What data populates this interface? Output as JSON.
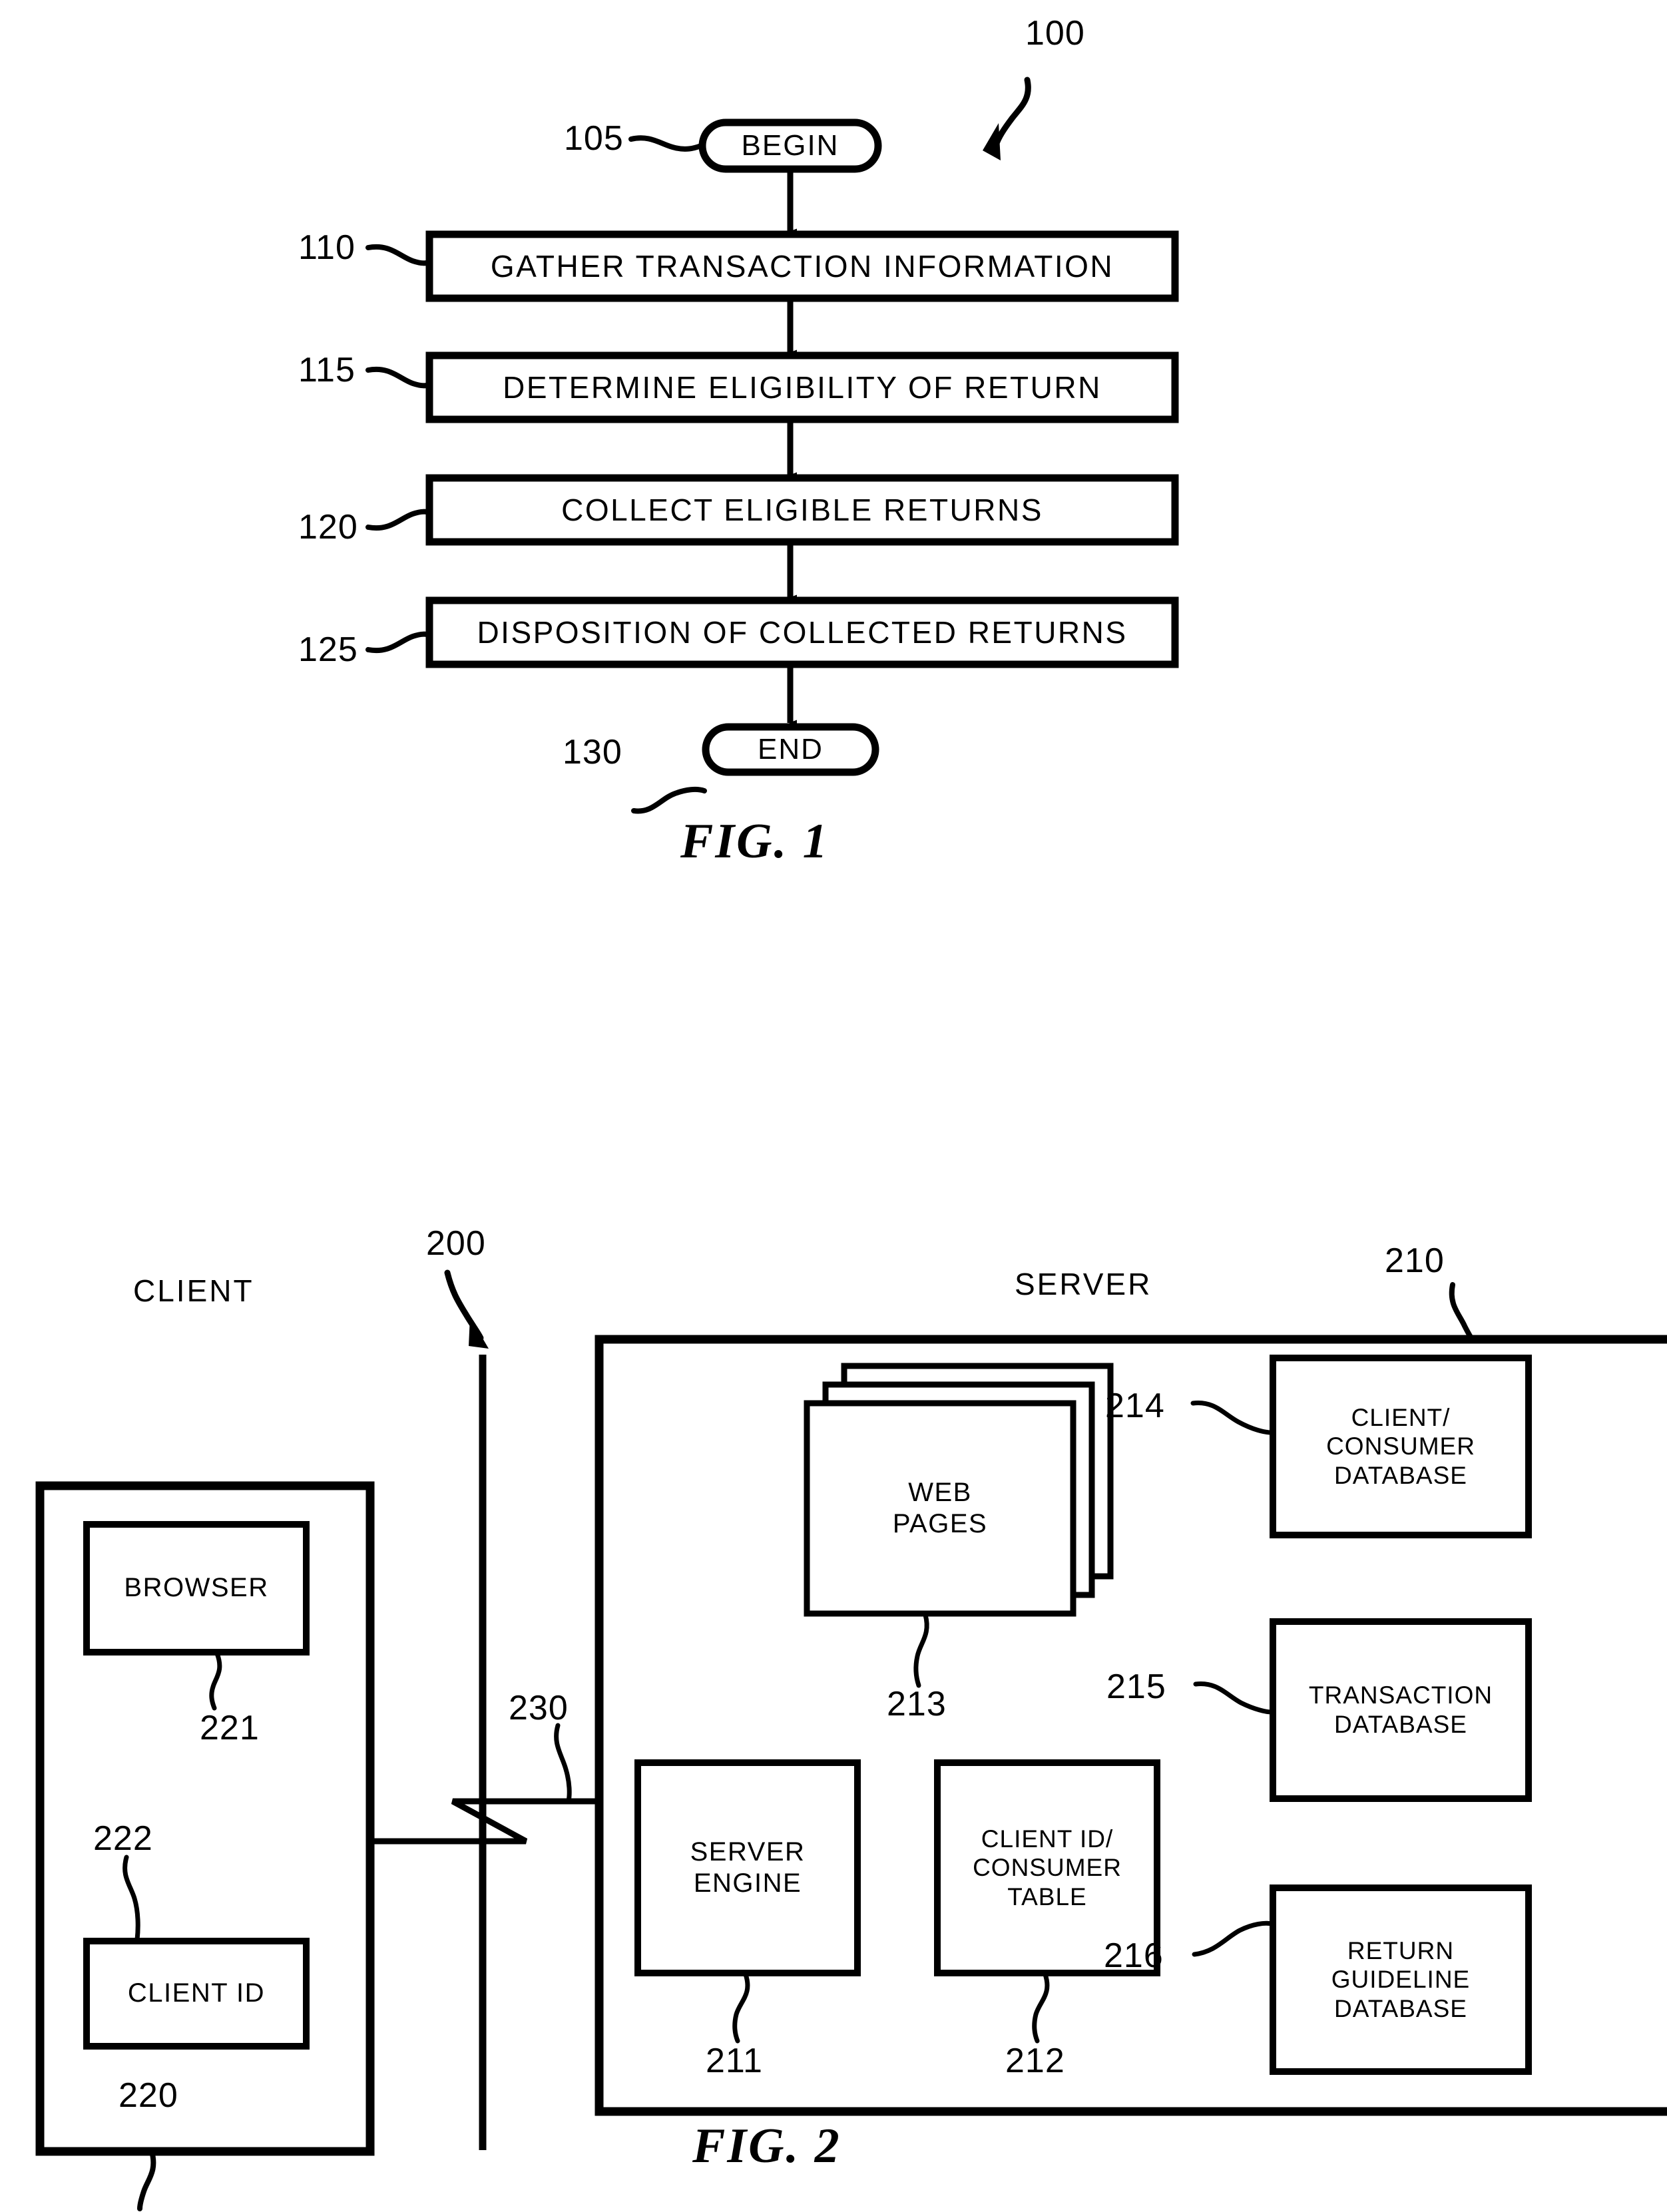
{
  "figure1": {
    "diagram_ref": "100",
    "caption": "FIG.  1",
    "nodes": [
      {
        "ref": "105",
        "label": "BEGIN",
        "shape": "terminator"
      },
      {
        "ref": "110",
        "label": "GATHER TRANSACTION INFORMATION",
        "shape": "process"
      },
      {
        "ref": "115",
        "label": "DETERMINE ELIGIBILITY OF RETURN",
        "shape": "process"
      },
      {
        "ref": "120",
        "label": "COLLECT ELIGIBLE RETURNS",
        "shape": "process"
      },
      {
        "ref": "125",
        "label": "DISPOSITION OF COLLECTED RETURNS",
        "shape": "process"
      },
      {
        "ref": "130",
        "label": "END",
        "shape": "terminator"
      }
    ]
  },
  "figure2": {
    "diagram_ref": "200",
    "caption": "FIG.  2",
    "client_title": "CLIENT",
    "server_title": "SERVER",
    "server_ref": "210",
    "client_ref": "220",
    "network_ref": "230",
    "client_nodes": [
      {
        "ref": "221",
        "label": "BROWSER"
      },
      {
        "ref": "222",
        "label": "CLIENT ID"
      }
    ],
    "server_nodes": [
      {
        "ref": "213",
        "label": "WEB\nPAGES"
      },
      {
        "ref": "214",
        "label": "CLIENT/\nCONSUMER\nDATABASE"
      },
      {
        "ref": "215",
        "label": "TRANSACTION\nDATABASE"
      },
      {
        "ref": "216",
        "label": "RETURN\nGUIDELINE\nDATABASE"
      },
      {
        "ref": "211",
        "label": "SERVER\nENGINE"
      },
      {
        "ref": "212",
        "label": "CLIENT ID/\nCONSUMER\nTABLE"
      }
    ]
  },
  "f1": {
    "n0": {
      "label": "BEGIN",
      "ref": "105"
    },
    "n1": {
      "label": "GATHER TRANSACTION INFORMATION",
      "ref": "110"
    },
    "n2": {
      "label": "DETERMINE ELIGIBILITY OF RETURN",
      "ref": "115"
    },
    "n3": {
      "label": "COLLECT ELIGIBLE RETURNS",
      "ref": "120"
    },
    "n4": {
      "label": "DISPOSITION OF COLLECTED RETURNS",
      "ref": "125"
    },
    "n5": {
      "label": "END",
      "ref": "130"
    },
    "sys": "100",
    "cap": "FIG.  1"
  },
  "f2": {
    "sys": "200",
    "cap": "FIG.  2",
    "client_title": "CLIENT",
    "server_title": "SERVER",
    "server_ref": "210",
    "client_ref": "220",
    "net_ref": "230",
    "browser": "BROWSER",
    "browser_ref": "221",
    "clientid": "CLIENT ID",
    "clientid_ref": "222",
    "webpages_l1": "WEB",
    "webpages_l2": "PAGES",
    "webpages_ref": "213",
    "ccdb_l1": "CLIENT/",
    "ccdb_l2": "CONSUMER",
    "ccdb_l3": "DATABASE",
    "ccdb_ref": "214",
    "txdb_l1": "TRANSACTION",
    "txdb_l2": "DATABASE",
    "txdb_ref": "215",
    "rgdb_l1": "RETURN",
    "rgdb_l2": "GUIDELINE",
    "rgdb_l3": "DATABASE",
    "rgdb_ref": "216",
    "engine_l1": "SERVER",
    "engine_l2": "ENGINE",
    "engine_ref": "211",
    "cctable_l1": "CLIENT ID/",
    "cctable_l2": "CONSUMER",
    "cctable_l3": "TABLE",
    "cctable_ref": "212"
  },
  "colors": {
    "ink": "#000000",
    "paper": "#ffffff"
  }
}
